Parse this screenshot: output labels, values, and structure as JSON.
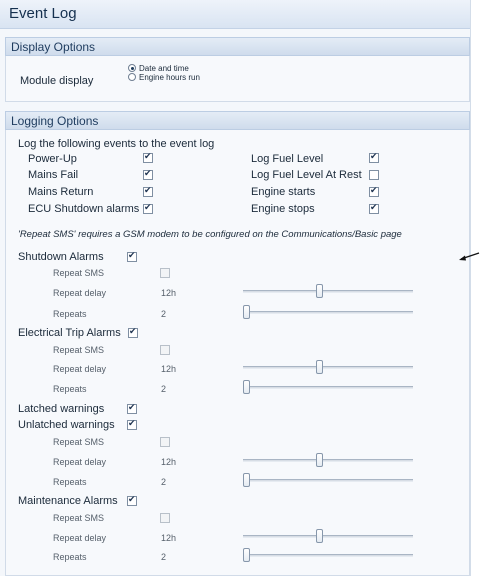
{
  "window": {
    "title": "Event Log"
  },
  "display_options": {
    "header": "Display Options",
    "module_display_label": "Module display",
    "options": [
      {
        "label": "Date and time",
        "selected": true
      },
      {
        "label": "Engine hours run",
        "selected": false
      }
    ]
  },
  "logging_options": {
    "header": "Logging Options",
    "intro": "Log the following events to the event log",
    "left_events": [
      {
        "label": "Power-Up",
        "checked": true
      },
      {
        "label": "Mains Fail",
        "checked": true
      },
      {
        "label": "Mains Return",
        "checked": true
      },
      {
        "label": "ECU Shutdown alarms",
        "checked": true
      }
    ],
    "right_events": [
      {
        "label": "Log Fuel Level",
        "checked": true
      },
      {
        "label": "Log Fuel Level At Rest",
        "checked": false
      },
      {
        "label": "Engine starts",
        "checked": true
      },
      {
        "label": "Engine stops",
        "checked": true
      }
    ],
    "sms_note": "'Repeat SMS' requires a GSM modem to be configured on the Communications/Basic page"
  },
  "alarm_groups": [
    {
      "label": "Shutdown Alarms",
      "checked": true,
      "repeat_sms_label": "Repeat SMS",
      "repeat_delay_label": "Repeat delay",
      "repeat_delay_value": "12h",
      "repeat_delay_level": 0.45,
      "repeats_label": "Repeats",
      "repeats_value": "2",
      "repeats_level": 0.0
    },
    {
      "label": "Electrical Trip Alarms",
      "checked": true,
      "repeat_sms_label": "Repeat SMS",
      "repeat_delay_label": "Repeat delay",
      "repeat_delay_value": "12h",
      "repeat_delay_level": 0.45,
      "repeats_label": "Repeats",
      "repeats_value": "2",
      "repeats_level": 0.0
    }
  ],
  "warnings": {
    "latched": {
      "label": "Latched warnings",
      "checked": true
    },
    "unlatched": {
      "label": "Unlatched warnings",
      "checked": true,
      "repeat_sms_label": "Repeat SMS",
      "repeat_delay_label": "Repeat delay",
      "repeat_delay_value": "12h",
      "repeat_delay_level": 0.45,
      "repeats_label": "Repeats",
      "repeats_value": "2",
      "repeats_level": 0.0
    }
  },
  "maintenance": {
    "label": "Maintenance Alarms",
    "checked": true,
    "repeat_sms_label": "Repeat SMS",
    "repeat_delay_label": "Repeat delay",
    "repeat_delay_value": "12h",
    "repeat_delay_level": 0.45,
    "repeats_label": "Repeats",
    "repeats_value": "2",
    "repeats_level": 0.0
  }
}
